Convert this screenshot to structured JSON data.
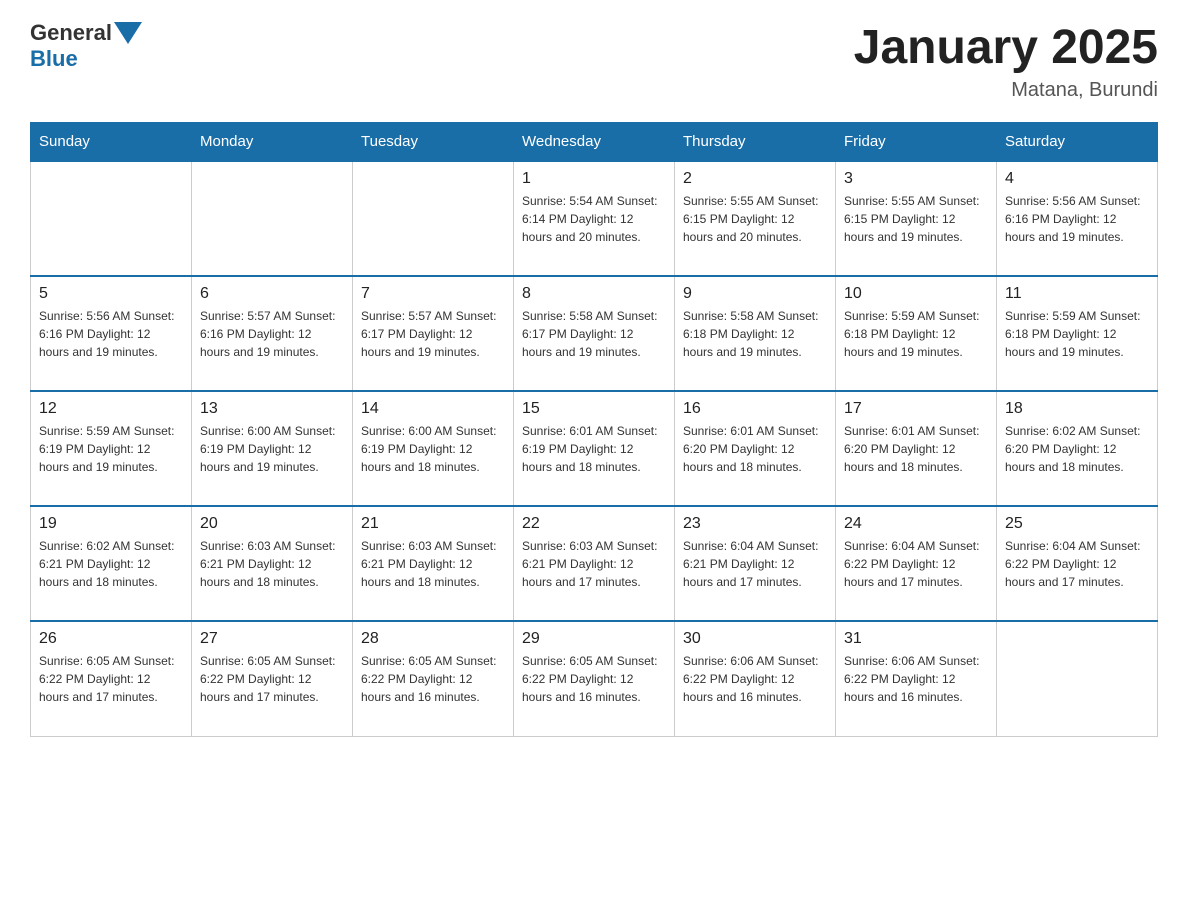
{
  "header": {
    "logo_text_general": "General",
    "logo_text_blue": "Blue",
    "title": "January 2025",
    "subtitle": "Matana, Burundi"
  },
  "days_of_week": [
    "Sunday",
    "Monday",
    "Tuesday",
    "Wednesday",
    "Thursday",
    "Friday",
    "Saturday"
  ],
  "weeks": [
    [
      {
        "day": "",
        "info": ""
      },
      {
        "day": "",
        "info": ""
      },
      {
        "day": "",
        "info": ""
      },
      {
        "day": "1",
        "info": "Sunrise: 5:54 AM\nSunset: 6:14 PM\nDaylight: 12 hours\nand 20 minutes."
      },
      {
        "day": "2",
        "info": "Sunrise: 5:55 AM\nSunset: 6:15 PM\nDaylight: 12 hours\nand 20 minutes."
      },
      {
        "day": "3",
        "info": "Sunrise: 5:55 AM\nSunset: 6:15 PM\nDaylight: 12 hours\nand 19 minutes."
      },
      {
        "day": "4",
        "info": "Sunrise: 5:56 AM\nSunset: 6:16 PM\nDaylight: 12 hours\nand 19 minutes."
      }
    ],
    [
      {
        "day": "5",
        "info": "Sunrise: 5:56 AM\nSunset: 6:16 PM\nDaylight: 12 hours\nand 19 minutes."
      },
      {
        "day": "6",
        "info": "Sunrise: 5:57 AM\nSunset: 6:16 PM\nDaylight: 12 hours\nand 19 minutes."
      },
      {
        "day": "7",
        "info": "Sunrise: 5:57 AM\nSunset: 6:17 PM\nDaylight: 12 hours\nand 19 minutes."
      },
      {
        "day": "8",
        "info": "Sunrise: 5:58 AM\nSunset: 6:17 PM\nDaylight: 12 hours\nand 19 minutes."
      },
      {
        "day": "9",
        "info": "Sunrise: 5:58 AM\nSunset: 6:18 PM\nDaylight: 12 hours\nand 19 minutes."
      },
      {
        "day": "10",
        "info": "Sunrise: 5:59 AM\nSunset: 6:18 PM\nDaylight: 12 hours\nand 19 minutes."
      },
      {
        "day": "11",
        "info": "Sunrise: 5:59 AM\nSunset: 6:18 PM\nDaylight: 12 hours\nand 19 minutes."
      }
    ],
    [
      {
        "day": "12",
        "info": "Sunrise: 5:59 AM\nSunset: 6:19 PM\nDaylight: 12 hours\nand 19 minutes."
      },
      {
        "day": "13",
        "info": "Sunrise: 6:00 AM\nSunset: 6:19 PM\nDaylight: 12 hours\nand 19 minutes."
      },
      {
        "day": "14",
        "info": "Sunrise: 6:00 AM\nSunset: 6:19 PM\nDaylight: 12 hours\nand 18 minutes."
      },
      {
        "day": "15",
        "info": "Sunrise: 6:01 AM\nSunset: 6:19 PM\nDaylight: 12 hours\nand 18 minutes."
      },
      {
        "day": "16",
        "info": "Sunrise: 6:01 AM\nSunset: 6:20 PM\nDaylight: 12 hours\nand 18 minutes."
      },
      {
        "day": "17",
        "info": "Sunrise: 6:01 AM\nSunset: 6:20 PM\nDaylight: 12 hours\nand 18 minutes."
      },
      {
        "day": "18",
        "info": "Sunrise: 6:02 AM\nSunset: 6:20 PM\nDaylight: 12 hours\nand 18 minutes."
      }
    ],
    [
      {
        "day": "19",
        "info": "Sunrise: 6:02 AM\nSunset: 6:21 PM\nDaylight: 12 hours\nand 18 minutes."
      },
      {
        "day": "20",
        "info": "Sunrise: 6:03 AM\nSunset: 6:21 PM\nDaylight: 12 hours\nand 18 minutes."
      },
      {
        "day": "21",
        "info": "Sunrise: 6:03 AM\nSunset: 6:21 PM\nDaylight: 12 hours\nand 18 minutes."
      },
      {
        "day": "22",
        "info": "Sunrise: 6:03 AM\nSunset: 6:21 PM\nDaylight: 12 hours\nand 17 minutes."
      },
      {
        "day": "23",
        "info": "Sunrise: 6:04 AM\nSunset: 6:21 PM\nDaylight: 12 hours\nand 17 minutes."
      },
      {
        "day": "24",
        "info": "Sunrise: 6:04 AM\nSunset: 6:22 PM\nDaylight: 12 hours\nand 17 minutes."
      },
      {
        "day": "25",
        "info": "Sunrise: 6:04 AM\nSunset: 6:22 PM\nDaylight: 12 hours\nand 17 minutes."
      }
    ],
    [
      {
        "day": "26",
        "info": "Sunrise: 6:05 AM\nSunset: 6:22 PM\nDaylight: 12 hours\nand 17 minutes."
      },
      {
        "day": "27",
        "info": "Sunrise: 6:05 AM\nSunset: 6:22 PM\nDaylight: 12 hours\nand 17 minutes."
      },
      {
        "day": "28",
        "info": "Sunrise: 6:05 AM\nSunset: 6:22 PM\nDaylight: 12 hours\nand 16 minutes."
      },
      {
        "day": "29",
        "info": "Sunrise: 6:05 AM\nSunset: 6:22 PM\nDaylight: 12 hours\nand 16 minutes."
      },
      {
        "day": "30",
        "info": "Sunrise: 6:06 AM\nSunset: 6:22 PM\nDaylight: 12 hours\nand 16 minutes."
      },
      {
        "day": "31",
        "info": "Sunrise: 6:06 AM\nSunset: 6:22 PM\nDaylight: 12 hours\nand 16 minutes."
      },
      {
        "day": "",
        "info": ""
      }
    ]
  ]
}
